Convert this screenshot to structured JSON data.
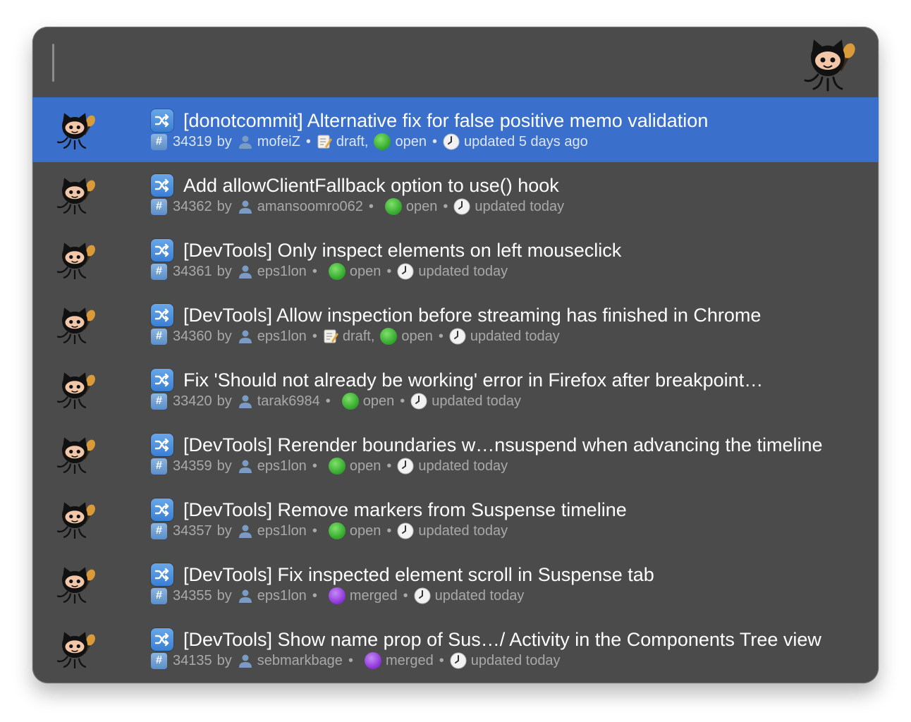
{
  "search": {
    "query": ""
  },
  "results": [
    {
      "title": "[donotcommit] Alternative fix for false positive memo validation",
      "number": "34319",
      "by": "by",
      "author": "mofeiZ",
      "draft_label": "draft,",
      "state_kind": "open",
      "state": "open",
      "updated": "updated 5 days ago",
      "selected": true
    },
    {
      "title": "Add allowClientFallback option to use() hook",
      "number": "34362",
      "by": "by",
      "author": "amansoomro062",
      "state_kind": "open",
      "state": "open",
      "updated": "updated today"
    },
    {
      "title": "[DevTools] Only inspect elements on left mouseclick",
      "number": "34361",
      "by": "by",
      "author": "eps1lon",
      "state_kind": "open",
      "state": "open",
      "updated": "updated today"
    },
    {
      "title": "[DevTools] Allow inspection before streaming has finished in Chrome",
      "number": "34360",
      "by": "by",
      "author": "eps1lon",
      "draft_label": "draft,",
      "state_kind": "open",
      "state": "open",
      "updated": "updated today"
    },
    {
      "title": "Fix 'Should not already be working' error in Firefox after breakpoint…",
      "number": "33420",
      "by": "by",
      "author": "tarak6984",
      "state_kind": "open",
      "state": "open",
      "updated": "updated today"
    },
    {
      "title": "[DevTools] Rerender boundaries w…nsuspend when advancing the timeline",
      "number": "34359",
      "by": "by",
      "author": "eps1lon",
      "state_kind": "open",
      "state": "open",
      "updated": "updated today"
    },
    {
      "title": "[DevTools] Remove markers from Suspense timeline",
      "number": "34357",
      "by": "by",
      "author": "eps1lon",
      "state_kind": "open",
      "state": "open",
      "updated": "updated today"
    },
    {
      "title": "[DevTools] Fix inspected element scroll in Suspense tab",
      "number": "34355",
      "by": "by",
      "author": "eps1lon",
      "state_kind": "merged",
      "state": "merged",
      "updated": "updated today"
    },
    {
      "title": "[DevTools] Show name prop of Sus…/ Activity in the Components Tree view",
      "number": "34135",
      "by": "by",
      "author": "sebmarkbage",
      "state_kind": "merged",
      "state": "merged",
      "updated": "updated today"
    }
  ],
  "icons": {
    "app_logo": "octocat-icon",
    "result_avatar": "octocat-icon",
    "pull_request": "shuffle-icon",
    "number": "hash-icon",
    "author": "person-icon",
    "draft": "memo-icon",
    "state": "status-dot-icon",
    "updated": "clock-icon"
  },
  "colors": {
    "window_bg": "#4b4b4b",
    "selected_row": "#3a6fcc",
    "open": "#2fa52a",
    "merged": "#8a2fd6"
  }
}
